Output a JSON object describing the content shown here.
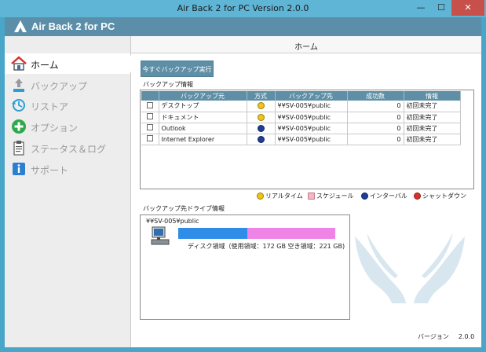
{
  "window": {
    "title": "Air Back 2 for PC Version 2.0.0",
    "minimize_glyph": "—",
    "maximize_glyph": "☐",
    "close_glyph": "✕"
  },
  "header": {
    "app_title": "Air Back 2 for PC"
  },
  "sidebar": {
    "items": [
      {
        "label": "ホーム",
        "icon": "home-icon",
        "active": true
      },
      {
        "label": "バックアップ",
        "icon": "upload-icon",
        "active": false
      },
      {
        "label": "リストア",
        "icon": "restore-icon",
        "active": false
      },
      {
        "label": "オプション",
        "icon": "plus-icon",
        "active": false
      },
      {
        "label": "ステータス＆ログ",
        "icon": "clipboard-icon",
        "active": false
      },
      {
        "label": "サポート",
        "icon": "info-icon",
        "active": false
      }
    ]
  },
  "main": {
    "page_title": "ホーム",
    "run_now_label": "今すぐバックアップ実行",
    "backup_info_label": "バックアップ情報",
    "table": {
      "columns": [
        "バックアップ元",
        "方式",
        "バックアップ先",
        "成功数",
        "情報"
      ],
      "rows": [
        {
          "checked": false,
          "source": "デスクトップ",
          "mode": "realtime",
          "dest": "¥¥SV-005¥public",
          "count": "0",
          "info": "初回未完了"
        },
        {
          "checked": false,
          "source": "ドキュメント",
          "mode": "realtime",
          "dest": "¥¥SV-005¥public",
          "count": "0",
          "info": "初回未完了"
        },
        {
          "checked": false,
          "source": "Outlook",
          "mode": "interval",
          "dest": "¥¥SV-005¥public",
          "count": "0",
          "info": "初回未完了"
        },
        {
          "checked": false,
          "source": "Internet Explorer",
          "mode": "interval",
          "dest": "¥¥SV-005¥public",
          "count": "0",
          "info": "初回未完了"
        }
      ]
    },
    "legend": [
      {
        "label": "リアルタイム",
        "icon": "realtime-icon"
      },
      {
        "label": "スケジュール",
        "icon": "schedule-icon"
      },
      {
        "label": "インターバル",
        "icon": "interval-icon"
      },
      {
        "label": "シャットダウン",
        "icon": "shutdown-icon"
      }
    ],
    "drive_info_label": "バックアップ先ドライブ情報",
    "drive": {
      "path": "¥¥SV-005¥public",
      "used_fraction": 0.44,
      "disk_text": "ディスク領域（使用領域：172 GB 空き領域：221 GB)"
    },
    "version_label": "バージョン",
    "version_value": "2.0.0"
  },
  "colors": {
    "accent": "#5f8fa6",
    "used": "#2f8de8",
    "free": "#ee85e6"
  }
}
